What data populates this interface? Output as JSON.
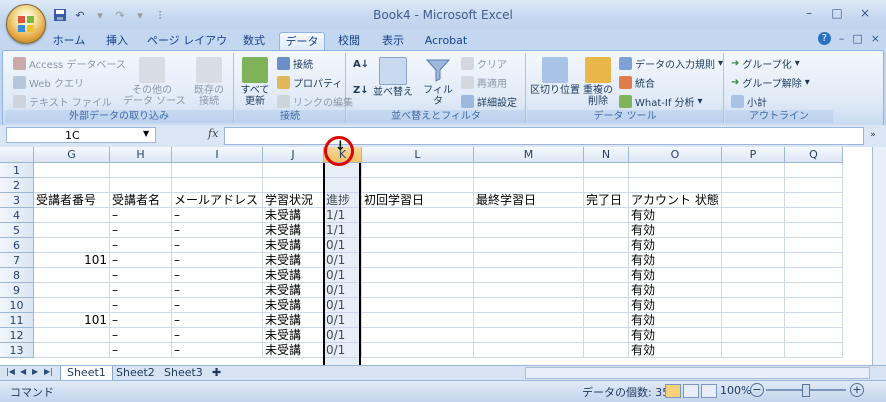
{
  "window": {
    "title": "Book4 - Microsoft Excel"
  },
  "win_controls": [
    "–",
    "□",
    "×"
  ],
  "help_controls": [
    "?",
    "–",
    "□",
    "×"
  ],
  "tabs": [
    "ホーム",
    "挿入",
    "ページ レイアウト",
    "数式",
    "データ",
    "校閲",
    "表示",
    "Acrobat"
  ],
  "ribbon": {
    "external": {
      "label": "外部データの取り込み",
      "access": "Access データベース",
      "web": "Web クエリ",
      "text": "テキスト ファイル",
      "other": "その他の\nデータ ソース",
      "existing": "既存の\n接続"
    },
    "connections": {
      "label": "接続",
      "refresh": "すべて\n更新",
      "conn": "接続",
      "props": "プロパティ",
      "edit_links": "リンクの編集"
    },
    "sort": {
      "label": "並べ替えとフィルタ",
      "sort_btn": "並べ替え",
      "filter": "フィルタ",
      "clear": "クリア",
      "reapply": "再適用",
      "advanced": "詳細設定"
    },
    "tools": {
      "label": "データ ツール",
      "split": "区切り位置",
      "dup": "重複の\n削除",
      "validate": "データの入力規則",
      "consolidate": "統合",
      "whatif": "What-If 分析"
    },
    "outline": {
      "label": "アウトライン",
      "group": "グループ化",
      "ungroup": "グループ解除",
      "subtotal": "小計"
    }
  },
  "formula_bar": {
    "name_box": "1C",
    "fx": "fx",
    "value": ""
  },
  "columns": [
    "G",
    "H",
    "I",
    "J",
    "K",
    "L",
    "M",
    "N",
    "O",
    "P",
    "Q"
  ],
  "selected_column": "K",
  "rows": [
    {
      "n": "1",
      "cells": [
        "",
        "",
        "",
        "",
        "",
        "",
        "",
        "",
        "",
        "",
        ""
      ]
    },
    {
      "n": "2",
      "cells": [
        "",
        "",
        "",
        "",
        "",
        "",
        "",
        "",
        "",
        "",
        ""
      ]
    },
    {
      "n": "3",
      "cells": [
        "受講者番号",
        "受講者名",
        "メールアドレス",
        "学習状況",
        "進捗",
        "初回学習日",
        "最終学習日",
        "完了日",
        "アカウント 状態",
        "",
        ""
      ]
    },
    {
      "n": "4",
      "cells": [
        "",
        "–",
        "–",
        "未受講",
        "1/1",
        "",
        "",
        "",
        "有効",
        "",
        ""
      ]
    },
    {
      "n": "5",
      "cells": [
        "",
        "–",
        "–",
        "未受講",
        "1/1",
        "",
        "",
        "",
        "有効",
        "",
        ""
      ]
    },
    {
      "n": "6",
      "cells": [
        "",
        "–",
        "–",
        "未受講",
        "0/1",
        "",
        "",
        "",
        "有効",
        "",
        ""
      ]
    },
    {
      "n": "7",
      "cells": [
        "101",
        "–",
        "–",
        "未受講",
        "0/1",
        "",
        "",
        "",
        "有効",
        "",
        ""
      ]
    },
    {
      "n": "8",
      "cells": [
        "",
        "–",
        "–",
        "未受講",
        "0/1",
        "",
        "",
        "",
        "有効",
        "",
        ""
      ]
    },
    {
      "n": "9",
      "cells": [
        "",
        "–",
        "–",
        "未受講",
        "0/1",
        "",
        "",
        "",
        "有効",
        "",
        ""
      ]
    },
    {
      "n": "10",
      "cells": [
        "",
        "–",
        "–",
        "未受講",
        "0/1",
        "",
        "",
        "",
        "有効",
        "",
        ""
      ]
    },
    {
      "n": "11",
      "cells": [
        "101",
        "–",
        "–",
        "未受講",
        "0/1",
        "",
        "",
        "",
        "有効",
        "",
        ""
      ]
    },
    {
      "n": "12",
      "cells": [
        "",
        "–",
        "–",
        "未受講",
        "0/1",
        "",
        "",
        "",
        "有効",
        "",
        ""
      ]
    },
    {
      "n": "13",
      "cells": [
        "",
        "–",
        "–",
        "未受講",
        "0/1",
        "",
        "",
        "",
        "有効",
        "",
        ""
      ]
    }
  ],
  "sheets": [
    "Sheet1",
    "Sheet2",
    "Sheet3"
  ],
  "status": {
    "mode": "コマンド",
    "count": "データの個数: 35",
    "zoom": "100%"
  }
}
